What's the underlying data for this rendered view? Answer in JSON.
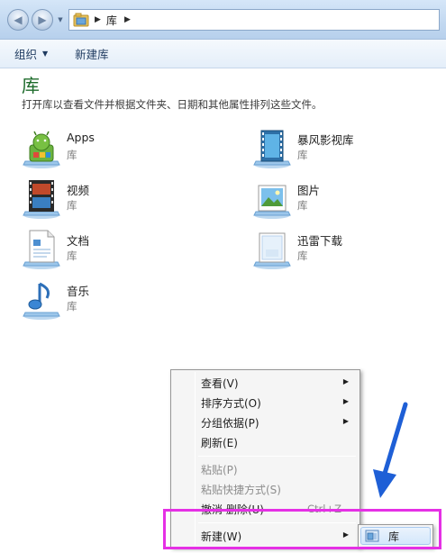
{
  "window": {
    "breadcrumb": [
      "库"
    ],
    "address_icon": "folder-library-icon"
  },
  "toolbar": {
    "organize_label": "组织",
    "new_library_label": "新建库"
  },
  "content": {
    "title": "库",
    "description": "打开库以查看文件并根据文件夹、日期和其他属性排列这些文件。",
    "items": [
      {
        "name": "Apps",
        "type": "库",
        "icon": "apps-library-icon"
      },
      {
        "name": "暴风影视库",
        "type": "库",
        "icon": "video-film-library-icon"
      },
      {
        "name": "视频",
        "type": "库",
        "icon": "videos-library-icon"
      },
      {
        "name": "图片",
        "type": "库",
        "icon": "pictures-library-icon"
      },
      {
        "name": "文档",
        "type": "库",
        "icon": "documents-library-icon"
      },
      {
        "name": "迅雷下载",
        "type": "库",
        "icon": "downloads-library-icon"
      },
      {
        "name": "音乐",
        "type": "库",
        "icon": "music-library-icon"
      }
    ]
  },
  "context_menu": {
    "items": [
      {
        "label": "查看(V)",
        "submenu": true,
        "disabled": false
      },
      {
        "label": "排序方式(O)",
        "submenu": true,
        "disabled": false
      },
      {
        "label": "分组依据(P)",
        "submenu": true,
        "disabled": false
      },
      {
        "label": "刷新(E)",
        "submenu": false,
        "disabled": false
      },
      {
        "label": "粘贴(P)",
        "submenu": false,
        "disabled": true
      },
      {
        "label": "粘贴快捷方式(S)",
        "submenu": false,
        "disabled": true
      },
      {
        "label": "撤消 删除(U)",
        "submenu": false,
        "disabled": false,
        "shortcut": "Ctrl+Z"
      },
      {
        "label": "新建(W)",
        "submenu": true,
        "disabled": false
      }
    ],
    "submenu_new": {
      "label": "库",
      "icon": "library-icon"
    }
  },
  "colors": {
    "title_green": "#1d6b2b",
    "highlight_magenta": "#e530e5",
    "arrow_blue": "#1e5fd6"
  }
}
